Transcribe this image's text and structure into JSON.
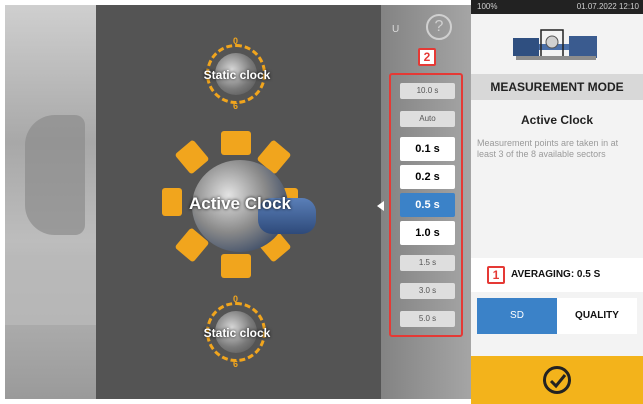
{
  "header": {
    "help_label": "?",
    "hu_text": "U"
  },
  "status_bar": {
    "battery": "100%",
    "datetime": "01.07.2022 12:10"
  },
  "clocks": {
    "top_label": "Static clock",
    "center_label": "Active Clock",
    "bottom_label": "Static clock",
    "top_marks": [
      "0",
      "6"
    ],
    "bottom_marks": [
      "0",
      "6"
    ]
  },
  "speed_selector": {
    "badge": "2",
    "items": [
      {
        "label": "10.0 s",
        "size": "small",
        "selected": false
      },
      {
        "label": "Auto",
        "size": "small",
        "selected": false
      },
      {
        "label": "0.1 s",
        "size": "big",
        "selected": false
      },
      {
        "label": "0.2 s",
        "size": "big",
        "selected": false
      },
      {
        "label": "0.5 s",
        "size": "big",
        "selected": true
      },
      {
        "label": "1.0 s",
        "size": "big",
        "selected": false
      },
      {
        "label": "1.5 s",
        "size": "small",
        "selected": false
      },
      {
        "label": "3.0 s",
        "size": "small",
        "selected": false
      },
      {
        "label": "5.0 s",
        "size": "small",
        "selected": false
      }
    ]
  },
  "panel": {
    "title": "MEASUREMENT MODE",
    "mode_name": "Active Clock",
    "description": "Measurement points are taken in at least 3 of the 8 available sectors",
    "averaging_badge": "1",
    "averaging_label": "AVERAGING: 0.5 S",
    "segment_sd": "SD",
    "segment_quality": "QUALITY"
  },
  "colors": {
    "accent_blue": "#3b82c8",
    "accent_orange": "#f1a51d",
    "highlight_red": "#e53935",
    "confirm_yellow": "#f3b31b"
  }
}
